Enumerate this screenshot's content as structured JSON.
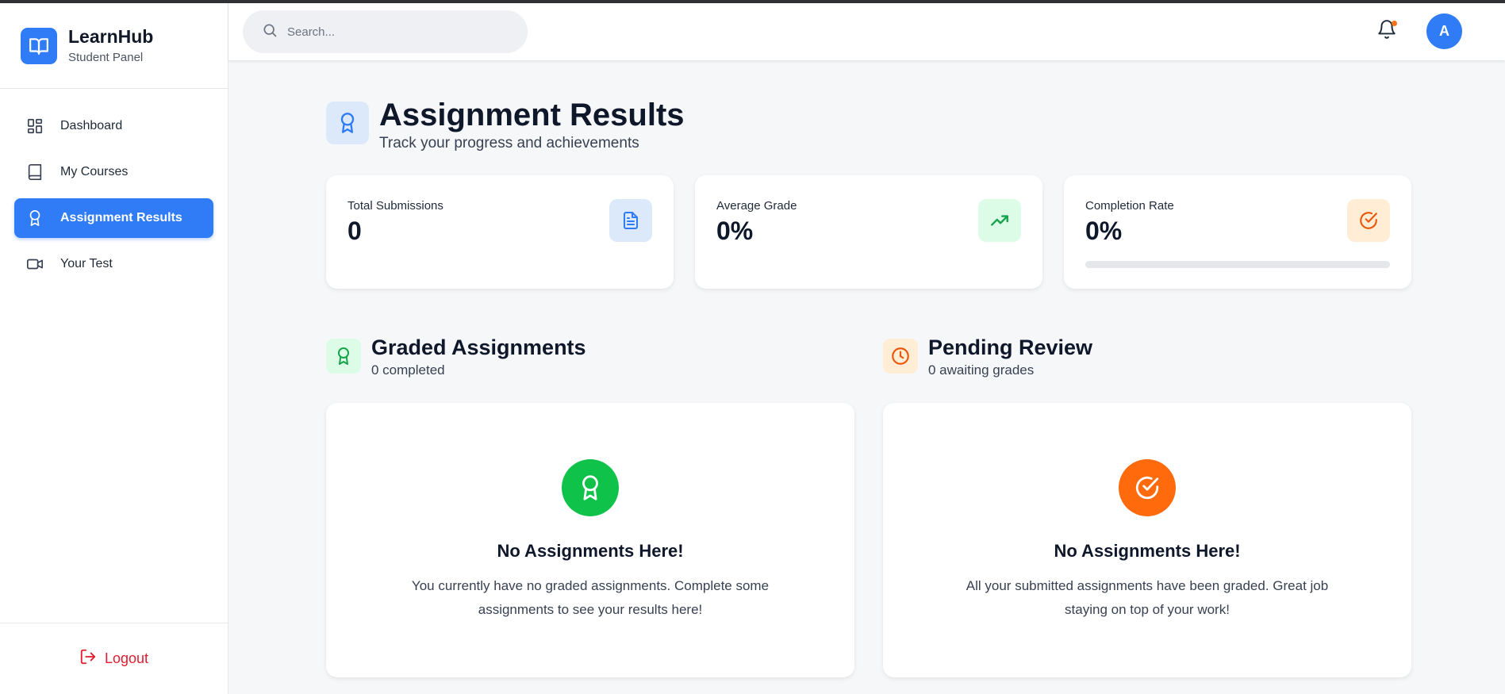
{
  "app": {
    "name": "LearnHub",
    "subtitle": "Student Panel"
  },
  "sidebar": {
    "items": [
      {
        "label": "Dashboard",
        "icon": "dashboard-icon",
        "active": false
      },
      {
        "label": "My Courses",
        "icon": "book-icon",
        "active": false
      },
      {
        "label": "Assignment Results",
        "icon": "award-icon",
        "active": true
      },
      {
        "label": "Your Test",
        "icon": "video-icon",
        "active": false
      }
    ],
    "logout_label": "Logout"
  },
  "header": {
    "search_placeholder": "Search...",
    "avatar_initial": "A",
    "has_notification": true
  },
  "page": {
    "title": "Assignment Results",
    "subtitle": "Track your progress and achievements"
  },
  "stats": [
    {
      "label": "Total Submissions",
      "value": "0",
      "icon": "document-icon",
      "color": "#2f7cf6",
      "bg": "#dce9fb"
    },
    {
      "label": "Average Grade",
      "value": "0%",
      "icon": "trending-up-icon",
      "color": "#16a34a",
      "bg": "#dcfce7"
    },
    {
      "label": "Completion Rate",
      "value": "0%",
      "icon": "check-circle-icon",
      "color": "#ea580c",
      "bg": "#ffedd5",
      "progress": 0
    }
  ],
  "sections": {
    "graded": {
      "title": "Graded Assignments",
      "subtitle": "0 completed",
      "empty_title": "No Assignments Here!",
      "empty_text": "You currently have no graded assignments. Complete some assignments to see your results here!",
      "color": "#0ec24a"
    },
    "pending": {
      "title": "Pending Review",
      "subtitle": "0 awaiting grades",
      "empty_title": "No Assignments Here!",
      "empty_text": "All your submitted assignments have been graded. Great job staying on top of your work!",
      "color": "#ff6a0d"
    }
  },
  "colors": {
    "accent": "#2f7cf6",
    "danger": "#e11d2f"
  }
}
